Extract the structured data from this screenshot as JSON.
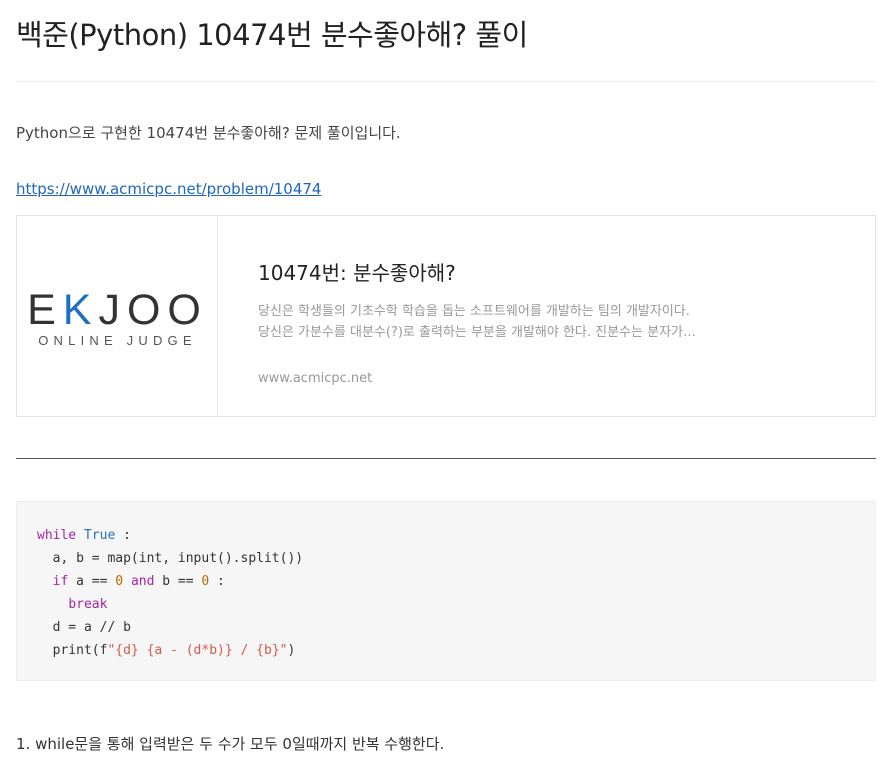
{
  "post": {
    "title": "백준(Python) 10474번 분수좋아해? 풀이",
    "intro": "Python으로 구현한 10474번 분수좋아해? 문제 풀이입니다.",
    "link_text": "https://www.acmicpc.net/problem/10474"
  },
  "og_card": {
    "logo_letters": [
      "E",
      "K",
      "JOO"
    ],
    "logo_sub": "ONLINE JUDGE",
    "title": "10474번: 분수좋아해?",
    "desc_line1": "당신은 학생들의 기초수학 학습을 돕는 소프트웨어를 개발하는 팀의 개발자이다.",
    "desc_line2": "당신은 가분수를 대분수(?)로 출력하는 부분을 개발해야 한다. 진분수는 분자가…",
    "domain": "www.acmicpc.net"
  },
  "code": {
    "language": "python",
    "lines": [
      "while True :",
      "  a, b = map(int, input().split())",
      "  if a == 0 and b == 0 :",
      "    break",
      "  d = a // b",
      "  print(f\"{d} {a - (d*b)} / {b}\")"
    ],
    "tokens": {
      "while": "while",
      "true": "True",
      "colon": " :",
      "line2": "a, b = map(int, input().split())",
      "if": "if",
      "a_eq": " a == ",
      "zero": "0",
      "and": "and",
      "b_eq": " b == ",
      "break": "break",
      "line5": "d = a // b",
      "print_open": "print(f",
      "fstring": "\"{d} {a - (d*b)} / {b}\"",
      "print_close": ")"
    }
  },
  "explanation": {
    "step1": "1. while문을 통해 입력받은 두 수가 모두 0일때까지 반복 수행한다."
  },
  "colors": {
    "link": "#2266bb",
    "logo_accent": "#1f6fc4",
    "code_keyword": "#a626a4",
    "code_builtin": "#2a6fb4",
    "code_number": "#b76b01",
    "code_string": "#d65a4a",
    "code_background": "#f6f6f6"
  }
}
